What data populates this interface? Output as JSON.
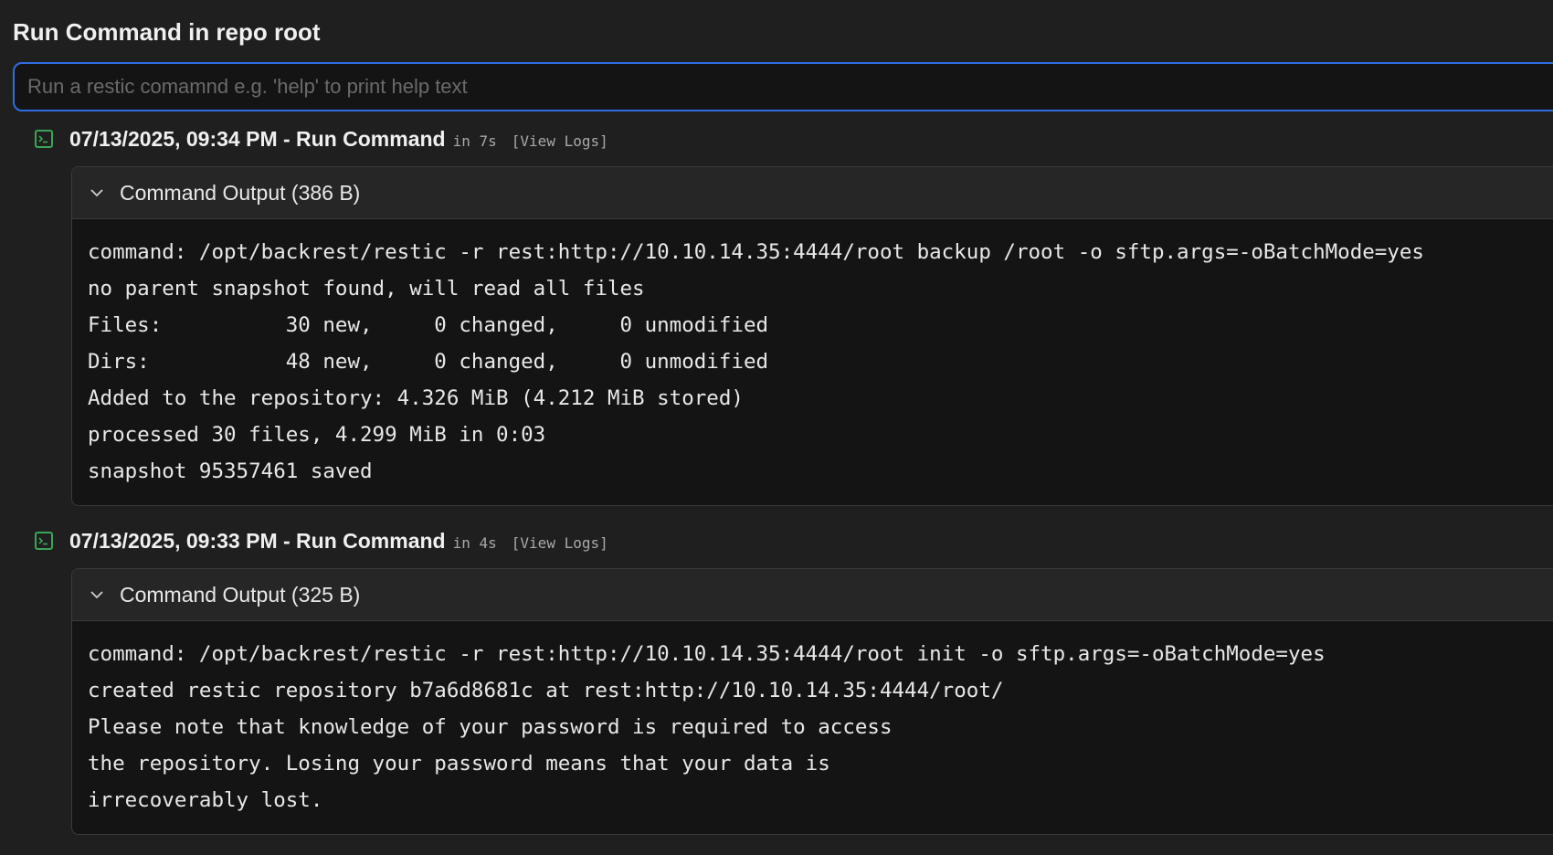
{
  "header": {
    "title": "Run Command in repo root"
  },
  "command_input": {
    "placeholder": "Run a restic comamnd e.g. 'help' to print help text",
    "value": ""
  },
  "entries": [
    {
      "icon": "terminal-icon",
      "title": "07/13/2025, 09:34 PM - Run Command",
      "duration": "in 7s",
      "view_logs_label": "[View Logs]",
      "output_label": "Command Output (386 B)",
      "output_text": "command: /opt/backrest/restic -r rest:http://10.10.14.35:4444/root backup /root -o sftp.args=-oBatchMode=yes\nno parent snapshot found, will read all files\nFiles:          30 new,     0 changed,     0 unmodified\nDirs:           48 new,     0 changed,     0 unmodified\nAdded to the repository: 4.326 MiB (4.212 MiB stored)\nprocessed 30 files, 4.299 MiB in 0:03\nsnapshot 95357461 saved"
    },
    {
      "icon": "terminal-icon",
      "title": "07/13/2025, 09:33 PM - Run Command",
      "duration": "in 4s",
      "view_logs_label": "[View Logs]",
      "output_label": "Command Output (325 B)",
      "output_text": "command: /opt/backrest/restic -r rest:http://10.10.14.35:4444/root init -o sftp.args=-oBatchMode=yes\ncreated restic repository b7a6d8681c at rest:http://10.10.14.35:4444/root/\nPlease note that knowledge of your password is required to access\nthe repository. Losing your password means that your data is\nirrecoverably lost."
    }
  ],
  "colors": {
    "background": "#1f1f1f",
    "input_border": "#2f6de1",
    "icon_green": "#3aa655",
    "muted_text": "#a8a8a8"
  }
}
